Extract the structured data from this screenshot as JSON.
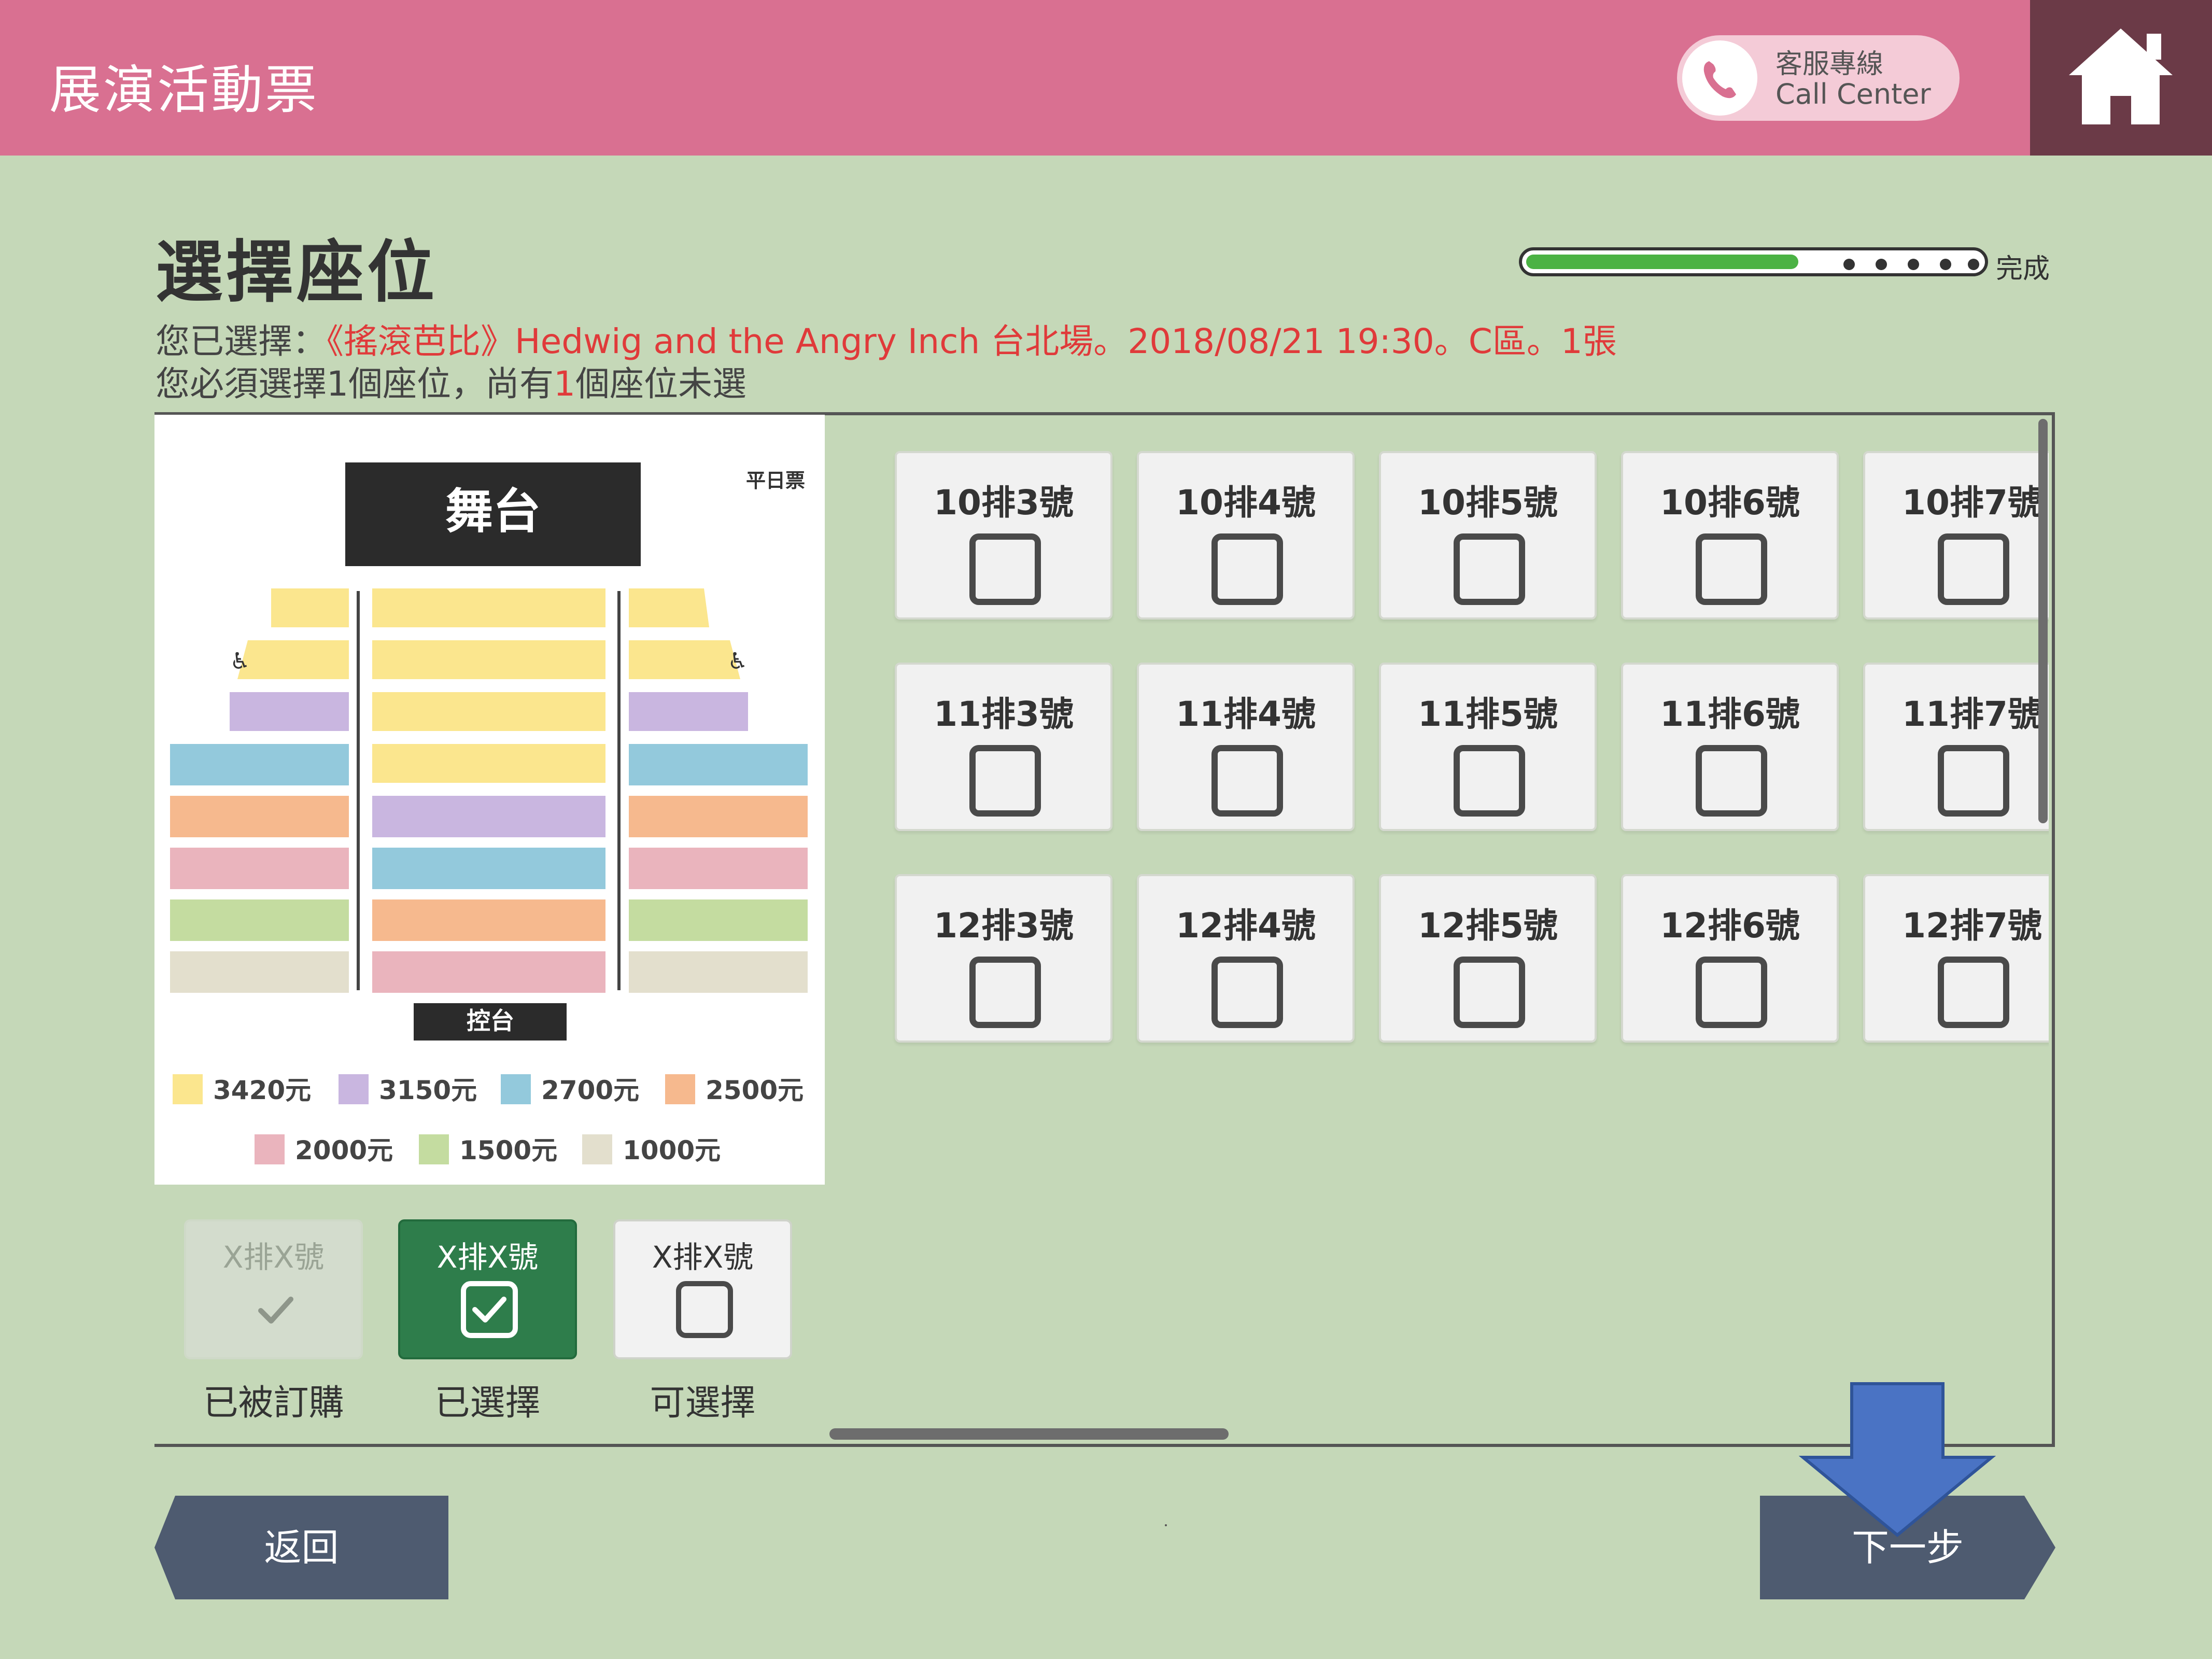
{
  "header": {
    "title": "展演活動票",
    "call_center_zh": "客服專線",
    "call_center_en": "Call Center"
  },
  "page": {
    "title": "選擇座位",
    "progress_label": "完成",
    "progress_fraction": 0.68,
    "selection_prefix": "您已選擇：",
    "selection_detail": "《搖滾芭比》Hedwig and the Angry Inch 台北場。2018/08/21 19:30。C區。1張",
    "requirement_part1": "您必須選擇1個座位，尚有",
    "requirement_count": "1",
    "requirement_part2": "個座位未選"
  },
  "seat_map": {
    "stage_label": "舞台",
    "control_label": "控台",
    "weekday_label": "平日票",
    "price_legend": [
      {
        "label": "3420元",
        "color": "#fbe68e"
      },
      {
        "label": "3150元",
        "color": "#c9b6e0"
      },
      {
        "label": "2700元",
        "color": "#93c9dc"
      },
      {
        "label": "2500元",
        "color": "#f6b98e"
      },
      {
        "label": "2000元",
        "color": "#eab4bd"
      },
      {
        "label": "1500元",
        "color": "#c4dca0"
      },
      {
        "label": "1000元",
        "color": "#e3dfcd"
      }
    ]
  },
  "seat_states": [
    {
      "sample": "X排X號",
      "caption": "已被訂購",
      "icon": "check-icon"
    },
    {
      "sample": "X排X號",
      "caption": "已選擇",
      "icon": "checked-box-icon"
    },
    {
      "sample": "X排X號",
      "caption": "可選擇",
      "icon": "empty-box-icon"
    }
  ],
  "seats": [
    {
      "label": "10排3號"
    },
    {
      "label": "10排4號"
    },
    {
      "label": "10排5號"
    },
    {
      "label": "10排6號"
    },
    {
      "label": "10排7號"
    },
    {
      "label": "11排3號"
    },
    {
      "label": "11排4號"
    },
    {
      "label": "11排5號"
    },
    {
      "label": "11排6號"
    },
    {
      "label": "11排7號"
    },
    {
      "label": "12排3號"
    },
    {
      "label": "12排4號"
    },
    {
      "label": "12排5號"
    },
    {
      "label": "12排6號"
    },
    {
      "label": "12排7號"
    }
  ],
  "nav": {
    "back_label": "返回",
    "next_label": "下一步"
  },
  "colors": {
    "header": "#d97091",
    "background": "#c5d8b8",
    "selected_green": "#2e7d4b",
    "nav_button": "#4e5b70",
    "arrow": "#4a73c4",
    "accent_red": "#e03a3a"
  }
}
